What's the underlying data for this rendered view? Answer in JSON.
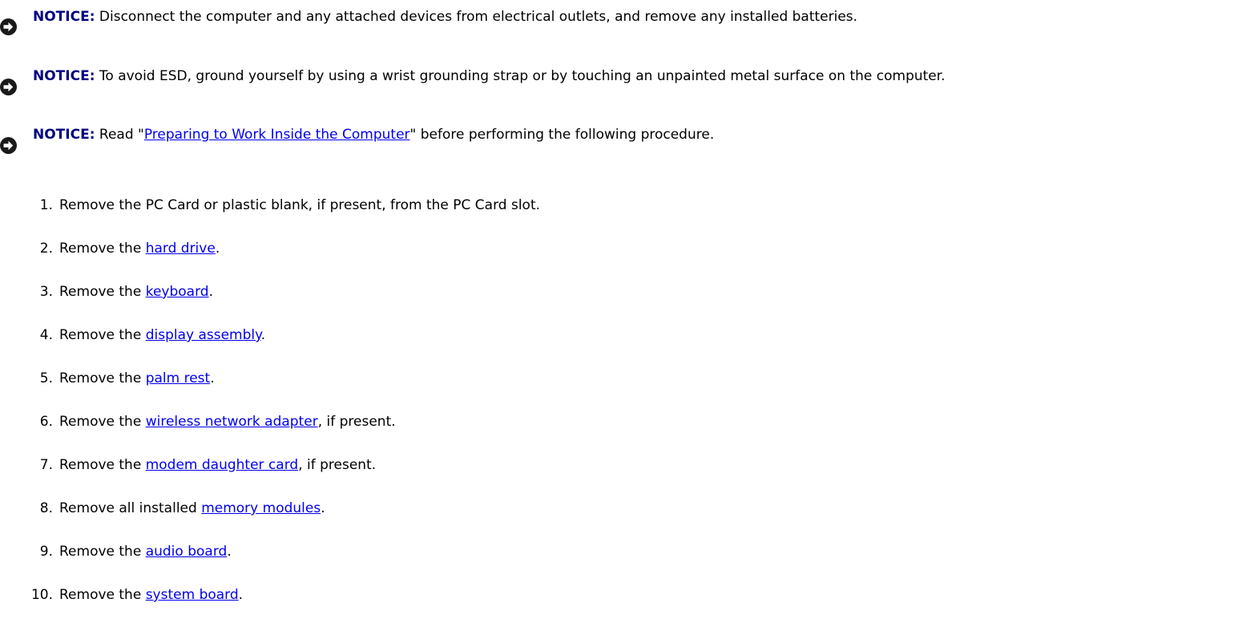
{
  "notices": [
    {
      "label": "NOTICE:",
      "text": " Disconnect the computer and any attached devices from electrical outlets, and remove any installed batteries."
    },
    {
      "label": "NOTICE:",
      "text": " To avoid ESD, ground yourself by using a wrist grounding strap or by touching an unpainted metal surface on the computer."
    },
    {
      "label": "NOTICE:",
      "pre": " Read \"",
      "link": "Preparing to Work Inside the Computer",
      "post": "\" before performing the following procedure."
    }
  ],
  "steps": [
    {
      "num": "1.",
      "pre": "Remove the PC Card or plastic blank, if present, from the PC Card slot.",
      "link": "",
      "post": ""
    },
    {
      "num": "2.",
      "pre": "Remove the ",
      "link": "hard drive",
      "post": "."
    },
    {
      "num": "3.",
      "pre": "Remove the ",
      "link": "keyboard",
      "post": "."
    },
    {
      "num": "4.",
      "pre": "Remove the ",
      "link": "display assembly",
      "post": "."
    },
    {
      "num": "5.",
      "pre": "Remove the ",
      "link": "palm rest",
      "post": "."
    },
    {
      "num": "6.",
      "pre": "Remove the ",
      "link": "wireless network adapter",
      "post": ", if present."
    },
    {
      "num": "7.",
      "pre": "Remove the ",
      "link": "modem daughter card",
      "post": ", if present."
    },
    {
      "num": "8.",
      "pre": "Remove all installed ",
      "link": "memory modules",
      "post": "."
    },
    {
      "num": "9.",
      "pre": "Remove the ",
      "link": "audio board",
      "post": "."
    },
    {
      "num": "10.",
      "pre": "Remove the ",
      "link": "system board",
      "post": "."
    }
  ],
  "icons": {
    "notice": "notice-arrow-icon"
  },
  "colors": {
    "notice_label": "#000080",
    "link": "#0000ee",
    "icon_fill": "#1a1a1a"
  }
}
